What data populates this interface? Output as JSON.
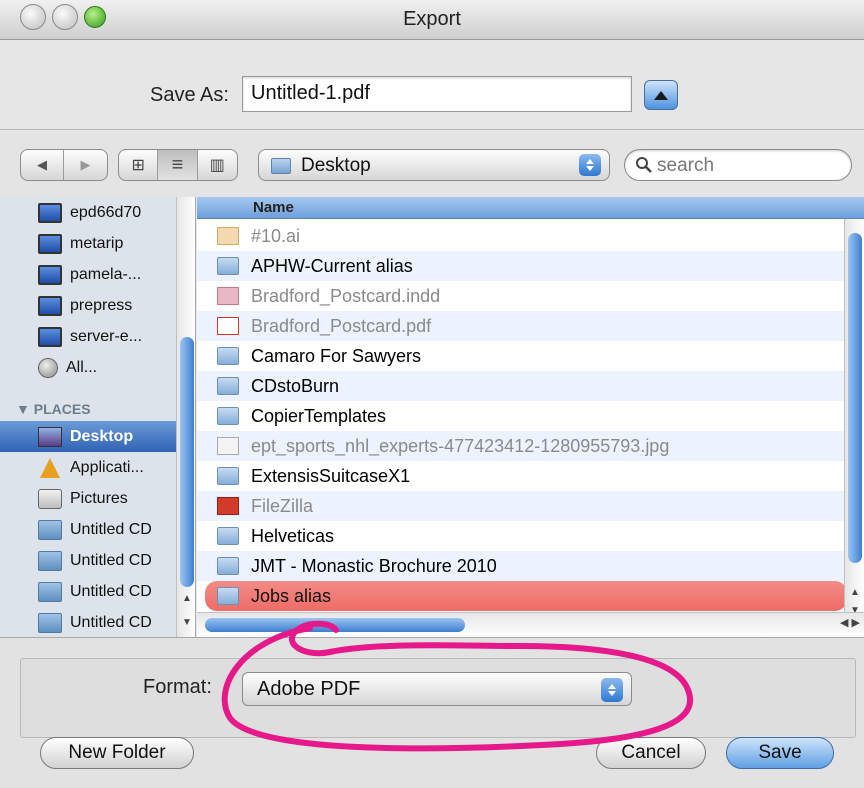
{
  "window": {
    "title": "Export"
  },
  "save_as": {
    "label": "Save As:",
    "value": "Untitled-1.pdf"
  },
  "toolbar": {
    "nav_back_icon": "◀",
    "nav_forward_icon": "▶",
    "view_icon_mode": "⊞",
    "view_list_mode": "≡",
    "view_column_mode": "▥",
    "location": "Desktop",
    "search_placeholder": "search"
  },
  "sidebar": {
    "devices": [
      {
        "label": "epd66d70",
        "icon": "monitor-icon"
      },
      {
        "label": "metarip",
        "icon": "monitor-icon"
      },
      {
        "label": "pamela-...",
        "icon": "monitor-icon"
      },
      {
        "label": "prepress",
        "icon": "monitor-icon"
      },
      {
        "label": "server-e...",
        "icon": "monitor-icon"
      },
      {
        "label": "All...",
        "icon": "globe-icon"
      }
    ],
    "places_header": "▼ PLACES",
    "places": [
      {
        "label": "Desktop",
        "icon": "desktop-icon",
        "selected": true
      },
      {
        "label": "Applicati...",
        "icon": "applications-icon"
      },
      {
        "label": "Pictures",
        "icon": "pictures-icon"
      },
      {
        "label": "Untitled CD",
        "icon": "cd-icon"
      },
      {
        "label": "Untitled CD",
        "icon": "cd-icon"
      },
      {
        "label": "Untitled CD",
        "icon": "cd-icon"
      },
      {
        "label": "Untitled CD",
        "icon": "cd-icon"
      }
    ]
  },
  "file_list": {
    "column_header": "Name",
    "rows": [
      {
        "name": "#10.ai",
        "icon": "ai-file-icon",
        "enabled": false
      },
      {
        "name": "APHW-Current alias",
        "icon": "folder-alias-icon",
        "enabled": true
      },
      {
        "name": "Bradford_Postcard.indd",
        "icon": "indd-file-icon",
        "enabled": false
      },
      {
        "name": "Bradford_Postcard.pdf",
        "icon": "pdf-file-icon",
        "enabled": false
      },
      {
        "name": "Camaro For Sawyers",
        "icon": "folder-icon",
        "enabled": true
      },
      {
        "name": "CDstoBurn",
        "icon": "folder-icon",
        "enabled": true
      },
      {
        "name": "CopierTemplates",
        "icon": "folder-icon",
        "enabled": true
      },
      {
        "name": "ept_sports_nhl_experts-477423412-1280955793.jpg",
        "icon": "jpg-file-icon",
        "enabled": false
      },
      {
        "name": "ExtensisSuitcaseX1",
        "icon": "folder-icon",
        "enabled": true
      },
      {
        "name": "FileZilla",
        "icon": "filezilla-icon",
        "enabled": false
      },
      {
        "name": "Helveticas",
        "icon": "folder-icon",
        "enabled": true
      },
      {
        "name": "JMT - Monastic Brochure 2010",
        "icon": "folder-icon",
        "enabled": true
      },
      {
        "name": "Jobs alias",
        "icon": "folder-alias-icon",
        "enabled": true,
        "selected": true
      }
    ]
  },
  "format": {
    "label": "Format:",
    "value": "Adobe PDF"
  },
  "buttons": {
    "new_folder": "New Folder",
    "cancel": "Cancel",
    "save": "Save"
  },
  "colors": {
    "selection": "#2f63b3",
    "highlight_row": "#ef6b66",
    "annotation": "#e5198a"
  }
}
